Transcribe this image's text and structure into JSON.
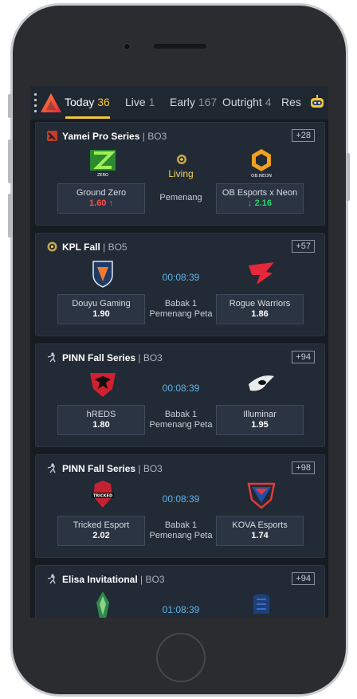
{
  "tabs": [
    {
      "label": "Today",
      "count": "36"
    },
    {
      "label": "Live",
      "count": "1"
    },
    {
      "label": "Early",
      "count": "167"
    },
    {
      "label": "Outright",
      "count": "4"
    },
    {
      "label": "Res",
      "count": ""
    }
  ],
  "matches": [
    {
      "league": "Yamei Pro Series",
      "bo": "| BO3",
      "more": "+28",
      "status": "Living",
      "left_team": "Ground Zero",
      "left_odd": "1.60 ↑",
      "right_team": "OB Esports x Neon",
      "right_odd": "↓ 2.16",
      "market": "Pemenang",
      "left_logo_text": "ZERO",
      "right_logo_text": "OB.NEON"
    },
    {
      "league": "KPL Fall",
      "bo": "| BO5",
      "more": "+57",
      "status": "00:08:39",
      "left_team": "Douyu Gaming",
      "left_odd": "1.90",
      "right_team": "Rogue Warriors",
      "right_odd": "1.86",
      "market": "Babak 1 Pemenang Peta"
    },
    {
      "league": "PINN Fall Series",
      "bo": "| BO3",
      "more": "+94",
      "status": "00:08:39",
      "left_team": "hREDS",
      "left_odd": "1.80",
      "right_team": "Illuminar",
      "right_odd": "1.95",
      "market": "Babak 1 Pemenang Peta"
    },
    {
      "league": "PINN Fall Series",
      "bo": "| BO3",
      "more": "+98",
      "status": "00:08:39",
      "left_team": "Tricked Esport",
      "left_odd": "2.02",
      "right_team": "KOVA Esports",
      "right_odd": "1.74",
      "market": "Babak 1 Pemenang Peta",
      "left_logo_text": "TRICKED"
    },
    {
      "league": "Elisa Invitational",
      "bo": "| BO3",
      "more": "+94",
      "status": "01:08:39"
    }
  ],
  "colors": {
    "accent": "#f3c83a",
    "live": "#5fb3e8",
    "down": "#ff4d4d",
    "up": "#2fd36f"
  }
}
